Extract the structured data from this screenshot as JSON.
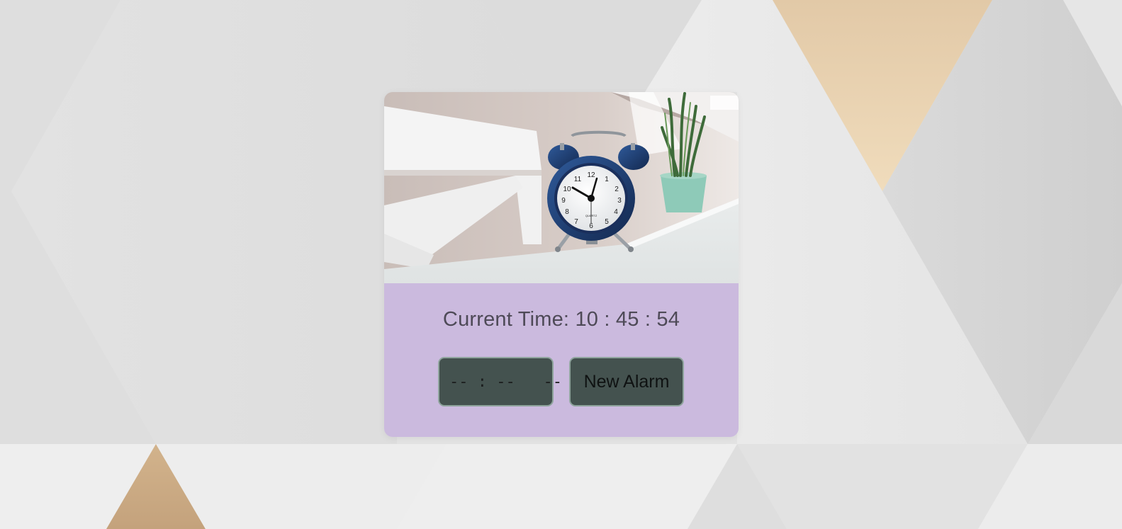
{
  "clock": {
    "label": "Current Time:",
    "hours": "10",
    "minutes": "45",
    "seconds": "54",
    "separator": ":"
  },
  "alarm_input": {
    "value": "-- : --   --"
  },
  "new_alarm_button": {
    "label": "New Alarm"
  },
  "photo": {
    "subject": "blue alarm clock on white table",
    "clock_face_numbers": [
      "12",
      "1",
      "2",
      "3",
      "4",
      "5",
      "6",
      "7",
      "8",
      "9",
      "10",
      "11"
    ],
    "clock_brand": "QUARTZ"
  },
  "colors": {
    "panel": "#cbbade",
    "control_bg": "#44524f",
    "control_border": "#8fa49d",
    "text": "#4e4a57"
  }
}
